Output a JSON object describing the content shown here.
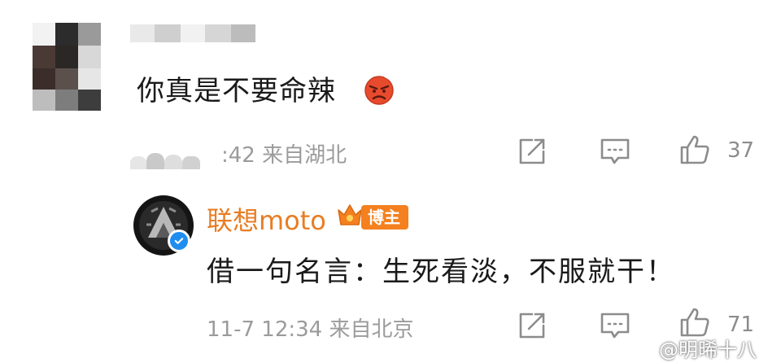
{
  "comment": {
    "text": "你真是不要命辣",
    "emoji": "angry-face",
    "meta": ":42  来自湖北",
    "like_count": "37"
  },
  "reply": {
    "author": "联想moto",
    "badge": "博主",
    "text": "借一句名言：生死看淡，不服就干！",
    "meta": "11-7 12:34  来自北京",
    "like_count": "71"
  },
  "watermark": "@明晞十八",
  "colors": {
    "accent": "#e87d24",
    "badge": "#f4801f",
    "verified": "#1f8df0",
    "meta": "#9b9b9b"
  }
}
